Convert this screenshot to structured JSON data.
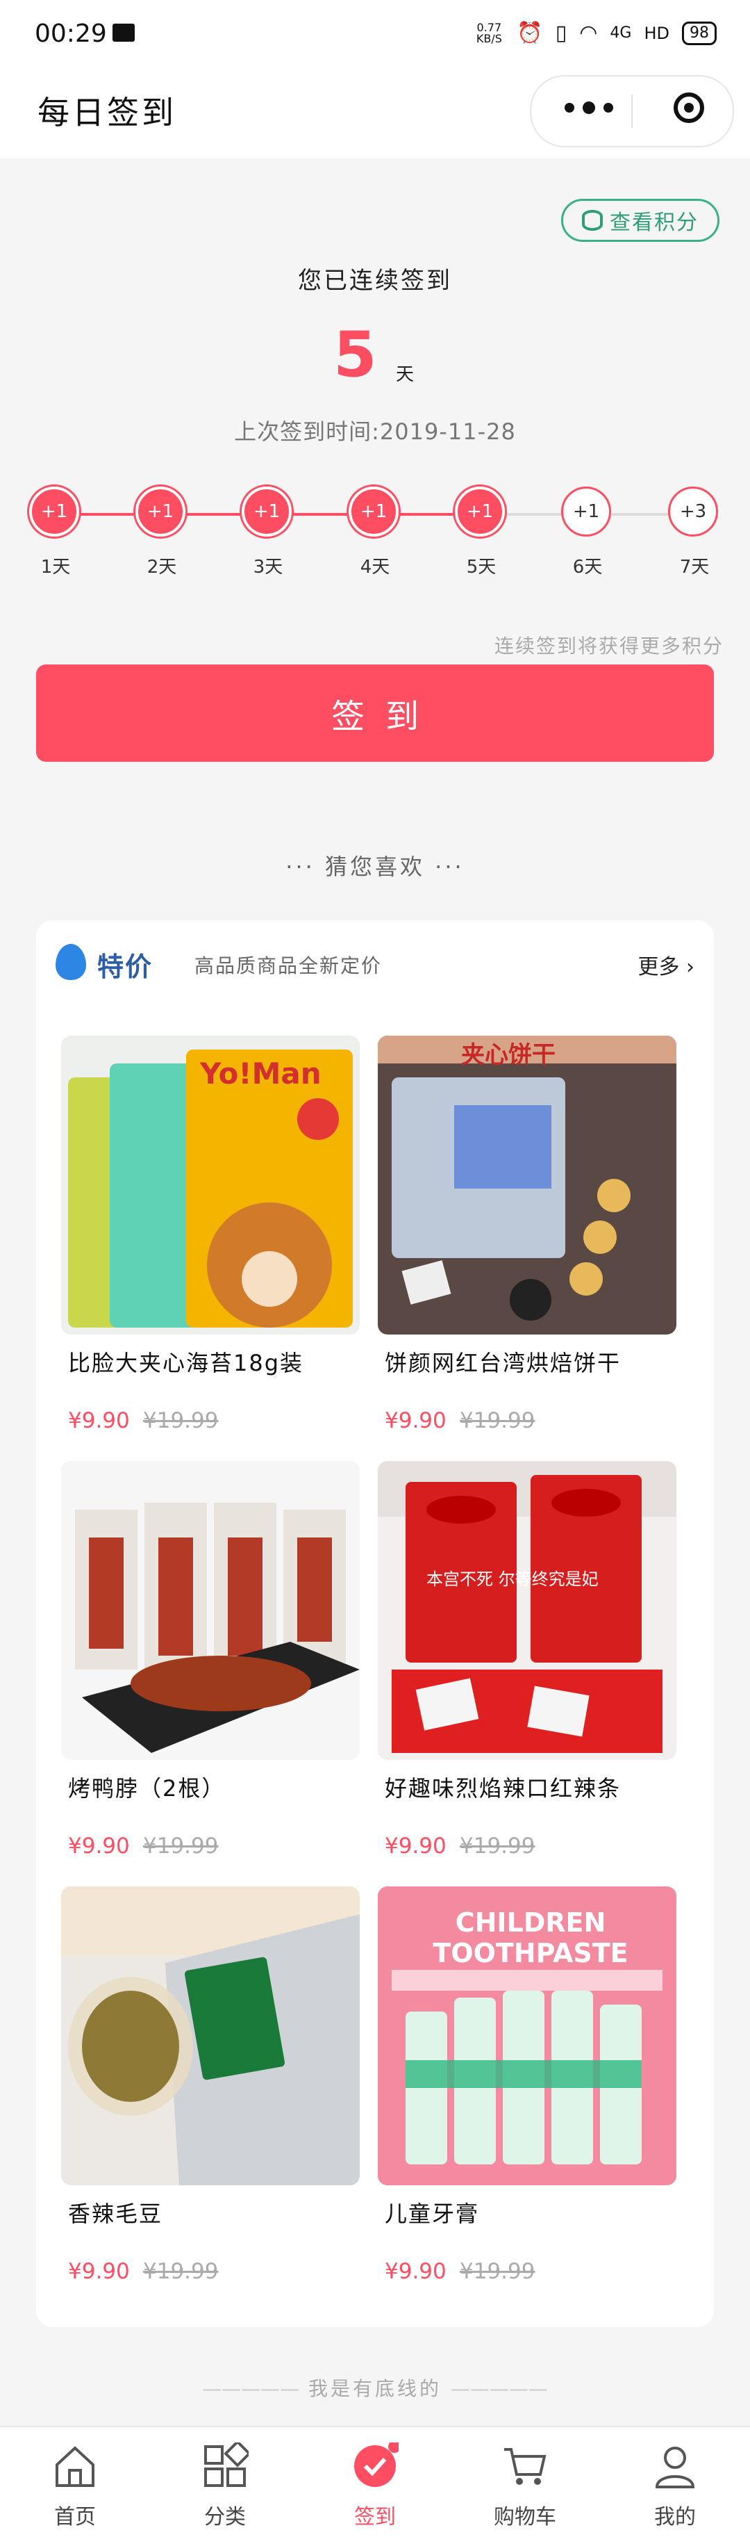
{
  "status": {
    "time": "00:29",
    "net_speed": "0.77 KB/S",
    "network": "4G",
    "hd": "HD",
    "battery": "98"
  },
  "nav": {
    "title": "每日签到"
  },
  "checkin": {
    "points_button": "查看积分",
    "streak_label": "您已连续签到",
    "streak_days": "5",
    "streak_unit": "天",
    "last_time": "上次签到时间:2019-11-28",
    "days": [
      {
        "points": "+1",
        "label": "1天",
        "done": true
      },
      {
        "points": "+1",
        "label": "2天",
        "done": true
      },
      {
        "points": "+1",
        "label": "3天",
        "done": true
      },
      {
        "points": "+1",
        "label": "4天",
        "done": true
      },
      {
        "points": "+1",
        "label": "5天",
        "done": true
      },
      {
        "points": "+1",
        "label": "6天",
        "done": false
      },
      {
        "points": "+3",
        "label": "7天",
        "done": false
      }
    ],
    "hint": "连续签到将获得更多积分",
    "sign_button": "签到"
  },
  "guess": {
    "title": "猜您喜欢"
  },
  "deals": {
    "title": "特价",
    "subtitle": "高品质商品全新定价",
    "more": "更多",
    "products": [
      {
        "name": "比脸大夹心海苔18g装",
        "price": "¥9.90",
        "original": "¥19.99",
        "image_text": "Yo!Man"
      },
      {
        "name": "饼颜网红台湾烘焙饼干",
        "price": "¥9.90",
        "original": "¥19.99",
        "image_text": "夹心饼干"
      },
      {
        "name": "烤鸭脖（2根）",
        "price": "¥9.90",
        "original": "¥19.99",
        "image_text": ""
      },
      {
        "name": "好趣味烈焰辣口红辣条",
        "price": "¥9.90",
        "original": "¥19.99",
        "image_text": "本宫不死 尔等终究是妃"
      },
      {
        "name": "香辣毛豆",
        "price": "¥9.90",
        "original": "¥19.99",
        "image_text": ""
      },
      {
        "name": "儿童牙膏",
        "price": "¥9.90",
        "original": "¥19.99",
        "image_text": "CHILDREN TOOTHPASTE"
      }
    ]
  },
  "bottom_note": "我是有底线的",
  "tabs": [
    {
      "label": "首页",
      "icon": "home-icon"
    },
    {
      "label": "分类",
      "icon": "category-icon"
    },
    {
      "label": "签到",
      "icon": "check-icon"
    },
    {
      "label": "购物车",
      "icon": "cart-icon"
    },
    {
      "label": "我的",
      "icon": "user-icon"
    }
  ],
  "colors": {
    "accent": "#ff4d61",
    "green": "#2f9d79",
    "blue": "#2e86e4"
  }
}
